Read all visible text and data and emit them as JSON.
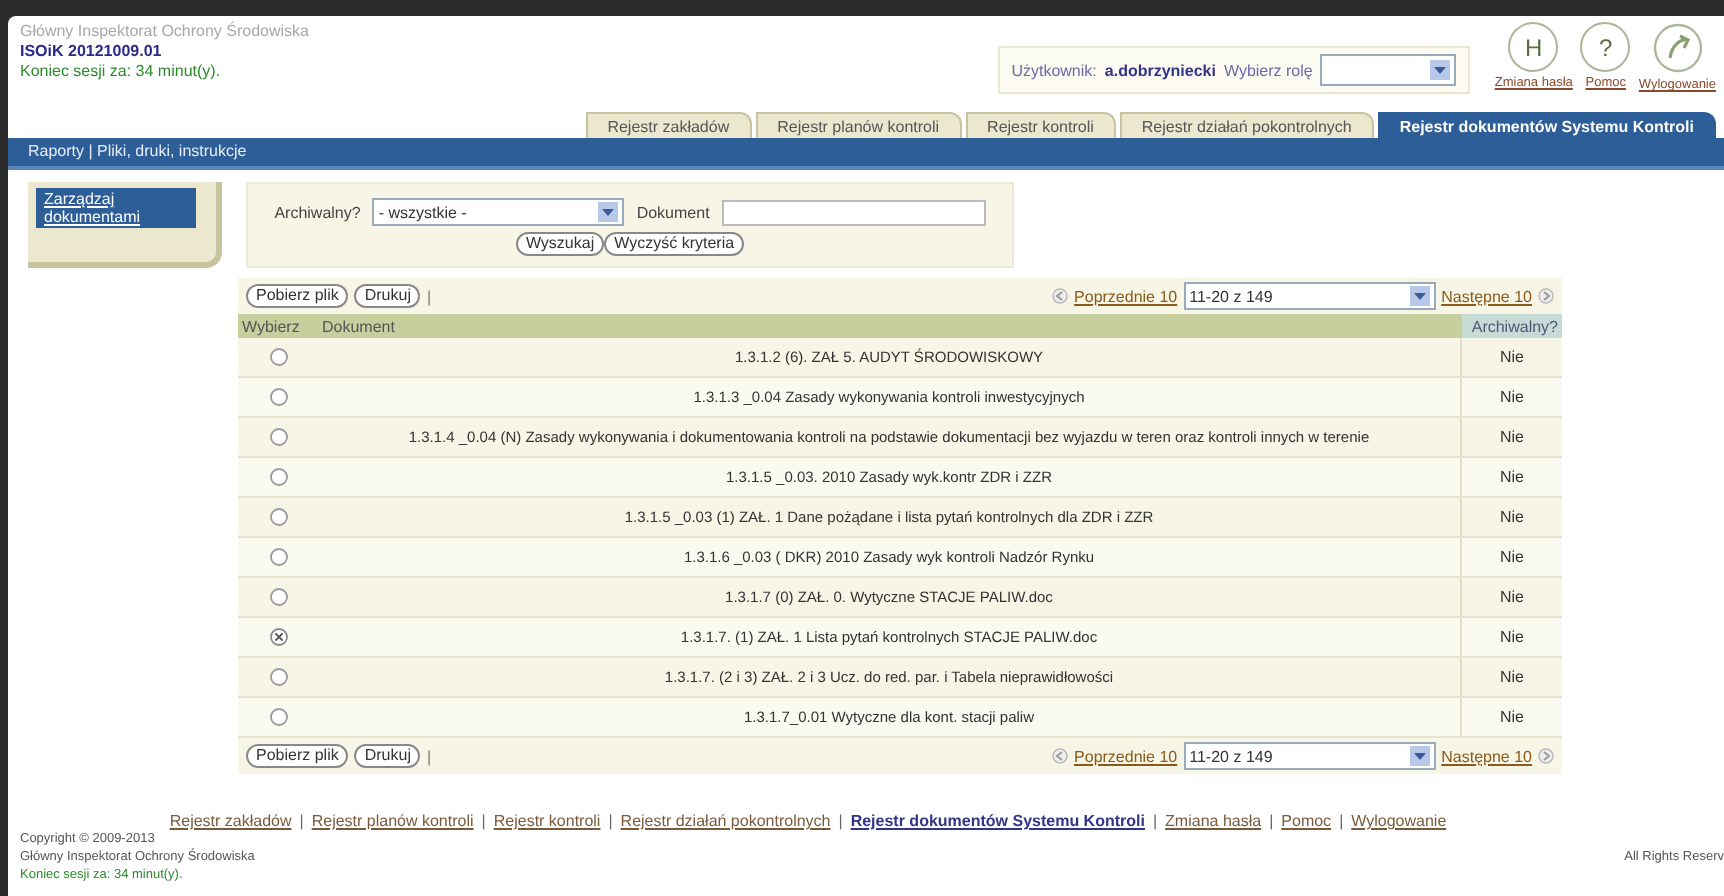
{
  "header": {
    "org": "Główny Inspektorat Ochrony Środowiska",
    "version": "ISOiK 20121009.01",
    "session": "Koniec sesji za: 34 minut(y)."
  },
  "user_box": {
    "user_label": "Użytkownik:",
    "user": "a.dobrzyniecki",
    "role_label": "Wybierz rolę"
  },
  "header_links": [
    {
      "glyph": "H",
      "label": "Zmiana hasła"
    },
    {
      "glyph": "?",
      "label": "Pomoc"
    },
    {
      "label": "Wylogowanie"
    }
  ],
  "tabs": [
    {
      "label": "Rejestr zakładów",
      "selected": false
    },
    {
      "label": "Rejestr planów kontroli",
      "selected": false
    },
    {
      "label": "Rejestr kontroli",
      "selected": false
    },
    {
      "label": "Rejestr działań pokontrolnych",
      "selected": false
    },
    {
      "label": "Rejestr dokumentów Systemu Kontroli",
      "selected": true
    }
  ],
  "breadcrumb": "Raporty | Pliki, druki, instrukcje",
  "sidebar": {
    "items": [
      {
        "label": "Zarządzaj dokumentami",
        "selected": true
      }
    ]
  },
  "filter": {
    "archived_label": "Archiwalny?",
    "archived_value": "- wszystkie -",
    "document_label": "Dokument",
    "buttons": [
      "Wyszukaj",
      "Wyczyść kryteria"
    ]
  },
  "toolbars": [
    {
      "buttons": [
        "Pobierz plik",
        "Drukuj"
      ],
      "divider": "|",
      "prev": "Poprzednie 10",
      "range": "11-20 z 149",
      "next": "Następne 10"
    },
    {
      "buttons": [
        "Pobierz plik",
        "Drukuj"
      ],
      "divider": "|",
      "prev": "Poprzednie 10",
      "range": "11-20 z 149",
      "next": "Następne 10"
    }
  ],
  "table": {
    "columns": [
      "Wybierz",
      "Dokument",
      "Archiwalny?"
    ],
    "rows": [
      {
        "document": "1.3.1.2 (6). ZAŁ 5. AUDYT ŚRODOWISKOWY",
        "archived": "Nie",
        "selected": false
      },
      {
        "document": "1.3.1.3 _0.04 Zasady wykonywania kontroli inwestycyjnych",
        "archived": "Nie",
        "selected": false
      },
      {
        "document": "1.3.1.4 _0.04 (N) Zasady wykonywania i dokumentowania kontroli na podstawie dokumentacji bez wyjazdu w teren oraz kontroli innych w terenie",
        "archived": "Nie",
        "selected": false
      },
      {
        "document": "1.3.1.5 _0.03. 2010 Zasady wyk.kontr ZDR i ZZR",
        "archived": "Nie",
        "selected": false
      },
      {
        "document": "1.3.1.5 _0.03 (1) ZAŁ. 1 Dane pożądane i lista pytań kontrolnych dla ZDR i ZZR",
        "archived": "Nie",
        "selected": false
      },
      {
        "document": "1.3.1.6 _0.03 ( DKR) 2010 Zasady wyk kontroli Nadzór Rynku",
        "archived": "Nie",
        "selected": false
      },
      {
        "document": "1.3.1.7 (0) ZAŁ. 0. Wytyczne STACJE PALIW.doc",
        "archived": "Nie",
        "selected": false
      },
      {
        "document": "1.3.1.7. (1) ZAŁ. 1 Lista pytań kontrolnych STACJE PALIW.doc",
        "archived": "Nie",
        "selected": true
      },
      {
        "document": "1.3.1.7. (2 i 3) ZAŁ. 2 i 3 Ucz. do red. par. i Tabela nieprawidłowości",
        "archived": "Nie",
        "selected": false
      },
      {
        "document": "1.3.1.7_0.01 Wytyczne dla kont. stacji paliw",
        "archived": "Nie",
        "selected": false
      }
    ]
  },
  "footer": {
    "links": [
      {
        "label": "Rejestr zakładów",
        "current": false
      },
      {
        "label": "Rejestr planów kontroli",
        "current": false
      },
      {
        "label": "Rejestr kontroli",
        "current": false
      },
      {
        "label": "Rejestr działań pokontrolnych",
        "current": false
      },
      {
        "label": "Rejestr dokumentów Systemu Kontroli",
        "current": true
      },
      {
        "label": "Zmiana hasła",
        "current": false
      },
      {
        "label": "Pomoc",
        "current": false
      },
      {
        "label": "Wylogowanie",
        "current": false
      }
    ],
    "separators": [
      "|",
      "|",
      "|",
      "|",
      "|",
      "|",
      "|"
    ],
    "copyright": "Copyright © 2009-2013",
    "org": "Główny Inspektorat Ochrony Środowiska",
    "session": "Koniec sesji za: 34 minut(y).",
    "rights": "All Rights Reserv"
  }
}
